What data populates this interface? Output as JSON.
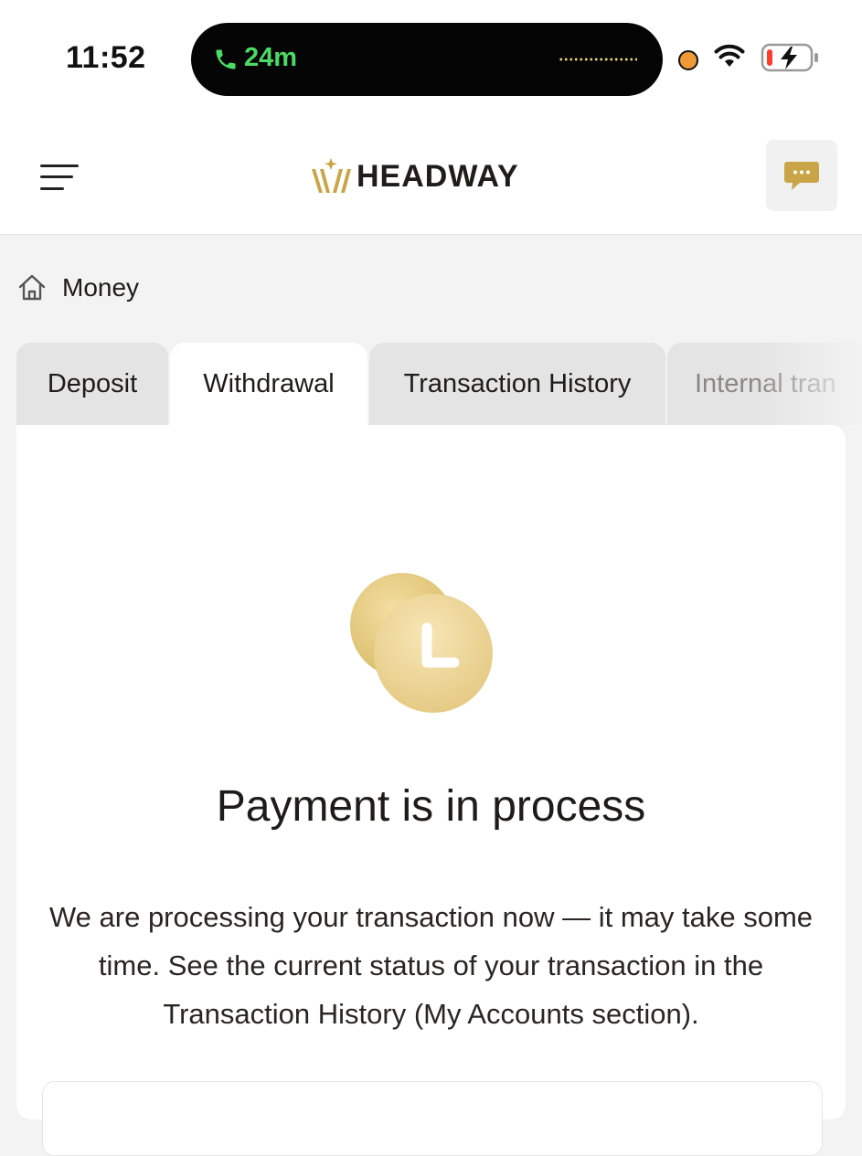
{
  "status_bar": {
    "time": "11:52",
    "call_duration": "24m",
    "call_color": "#4cd964",
    "recording_dot_color": "#f09a37",
    "battery_state": "charging-low"
  },
  "header": {
    "menu_icon": "hamburger-menu-icon",
    "brand_name": "HEADWAY",
    "brand_color": "#c9a547",
    "chat_icon": "chat-bubble-icon"
  },
  "breadcrumb": {
    "icon": "home-icon",
    "label": "Money"
  },
  "tabs": [
    {
      "label": "Deposit",
      "active": false
    },
    {
      "label": "Withdrawal",
      "active": true
    },
    {
      "label": "Transaction History",
      "active": false
    },
    {
      "label": "Internal tran",
      "active": false
    }
  ],
  "status": {
    "icon": "pending-clock-icon",
    "title": "Payment is in process",
    "message": "We are processing your transaction now — it may take some time. See the current status of your transaction in the Transaction History (My Accounts section)."
  }
}
